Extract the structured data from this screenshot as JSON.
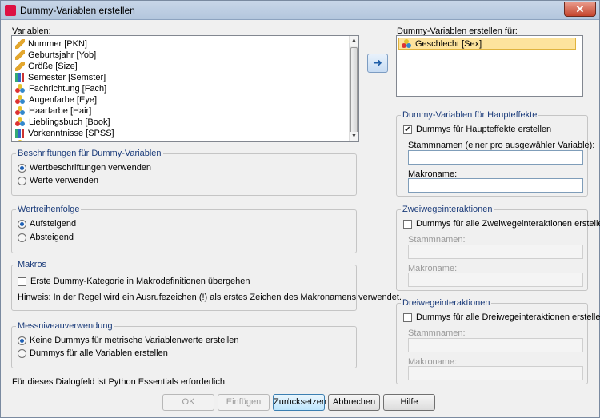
{
  "window": {
    "title": "Dummy-Variablen erstellen",
    "close_glyph": "✕"
  },
  "variables": {
    "label": "Variablen:",
    "items": [
      {
        "label": "Nummer [PKN]",
        "icon": "scale-icon"
      },
      {
        "label": "Geburtsjahr [Yob]",
        "icon": "scale-icon"
      },
      {
        "label": "Größe [Size]",
        "icon": "scale-icon"
      },
      {
        "label": "Semester [Semster]",
        "icon": "ordinal-icon"
      },
      {
        "label": "Fachrichtung [Fach]",
        "icon": "nominal-icon"
      },
      {
        "label": "Augenfarbe [Eye]",
        "icon": "nominal-icon"
      },
      {
        "label": "Haarfarbe [Hair]",
        "icon": "nominal-icon"
      },
      {
        "label": "Lieblingsbuch [Book]",
        "icon": "nominal-icon"
      },
      {
        "label": "Vorkenntnisse [SPSS]",
        "icon": "ordinal-icon"
      },
      {
        "label": "Pflicht [Pflicht]",
        "icon": "nominal-icon"
      }
    ]
  },
  "move_button": {
    "glyph": "➜"
  },
  "target": {
    "label": "Dummy-Variablen erstellen für:",
    "items": [
      {
        "label": "Geschlecht [Sex]",
        "icon": "nominal-icon"
      }
    ]
  },
  "beschriftungen": {
    "title": "Beschriftungen für Dummy-Variablen",
    "options": [
      {
        "label": "Wertbeschriftungen verwenden",
        "selected": true
      },
      {
        "label": "Werte verwenden",
        "selected": false
      }
    ]
  },
  "wertreihenfolge": {
    "title": "Wertreihenfolge",
    "options": [
      {
        "label": "Aufsteigend",
        "selected": true
      },
      {
        "label": "Absteigend",
        "selected": false
      }
    ]
  },
  "makros": {
    "title": "Makros",
    "checkbox_label": "Erste Dummy-Kategorie in Makrodefinitionen übergehen",
    "hint": "Hinweis: In der Regel wird ein Ausrufezeichen (!) als erstes Zeichen des Makronamens verwendet."
  },
  "messniveau": {
    "title": "Messniveauverwendung",
    "options": [
      {
        "label": "Keine Dummys für metrische Variablenwerte erstellen",
        "selected": true
      },
      {
        "label": "Dummys für alle Variablen erstellen",
        "selected": false
      }
    ]
  },
  "note": "Für dieses Dialogfeld ist Python Essentials erforderlich",
  "haupteffekte": {
    "title": "Dummy-Variablen für Haupteffekte",
    "checkbox_label": "Dummys für Haupteffekte erstellen",
    "check_glyph": "✔",
    "stamm_label": "Stammnamen (einer pro ausgewähler Variable):",
    "stamm_value": "",
    "makro_label": "Makroname:",
    "makro_value": ""
  },
  "zweiwege": {
    "title": "Zweiwegeinteraktionen",
    "checkbox_label": "Dummys für alle Zweiwegeinteraktionen erstellen",
    "stamm_label": "Stammnamen:",
    "makro_label": "Makroname:"
  },
  "dreiwege": {
    "title": "Dreiwegeinteraktionen",
    "checkbox_label": "Dummys für alle Dreiwegeinteraktionen erstellen",
    "stamm_label": "Stammnamen:",
    "makro_label": "Makroname:"
  },
  "buttons": {
    "ok": "OK",
    "einfuegen": "Einfügen",
    "zuruecksetzen": "Zurücksetzen",
    "abbrechen": "Abbrechen",
    "hilfe": "Hilfe"
  }
}
